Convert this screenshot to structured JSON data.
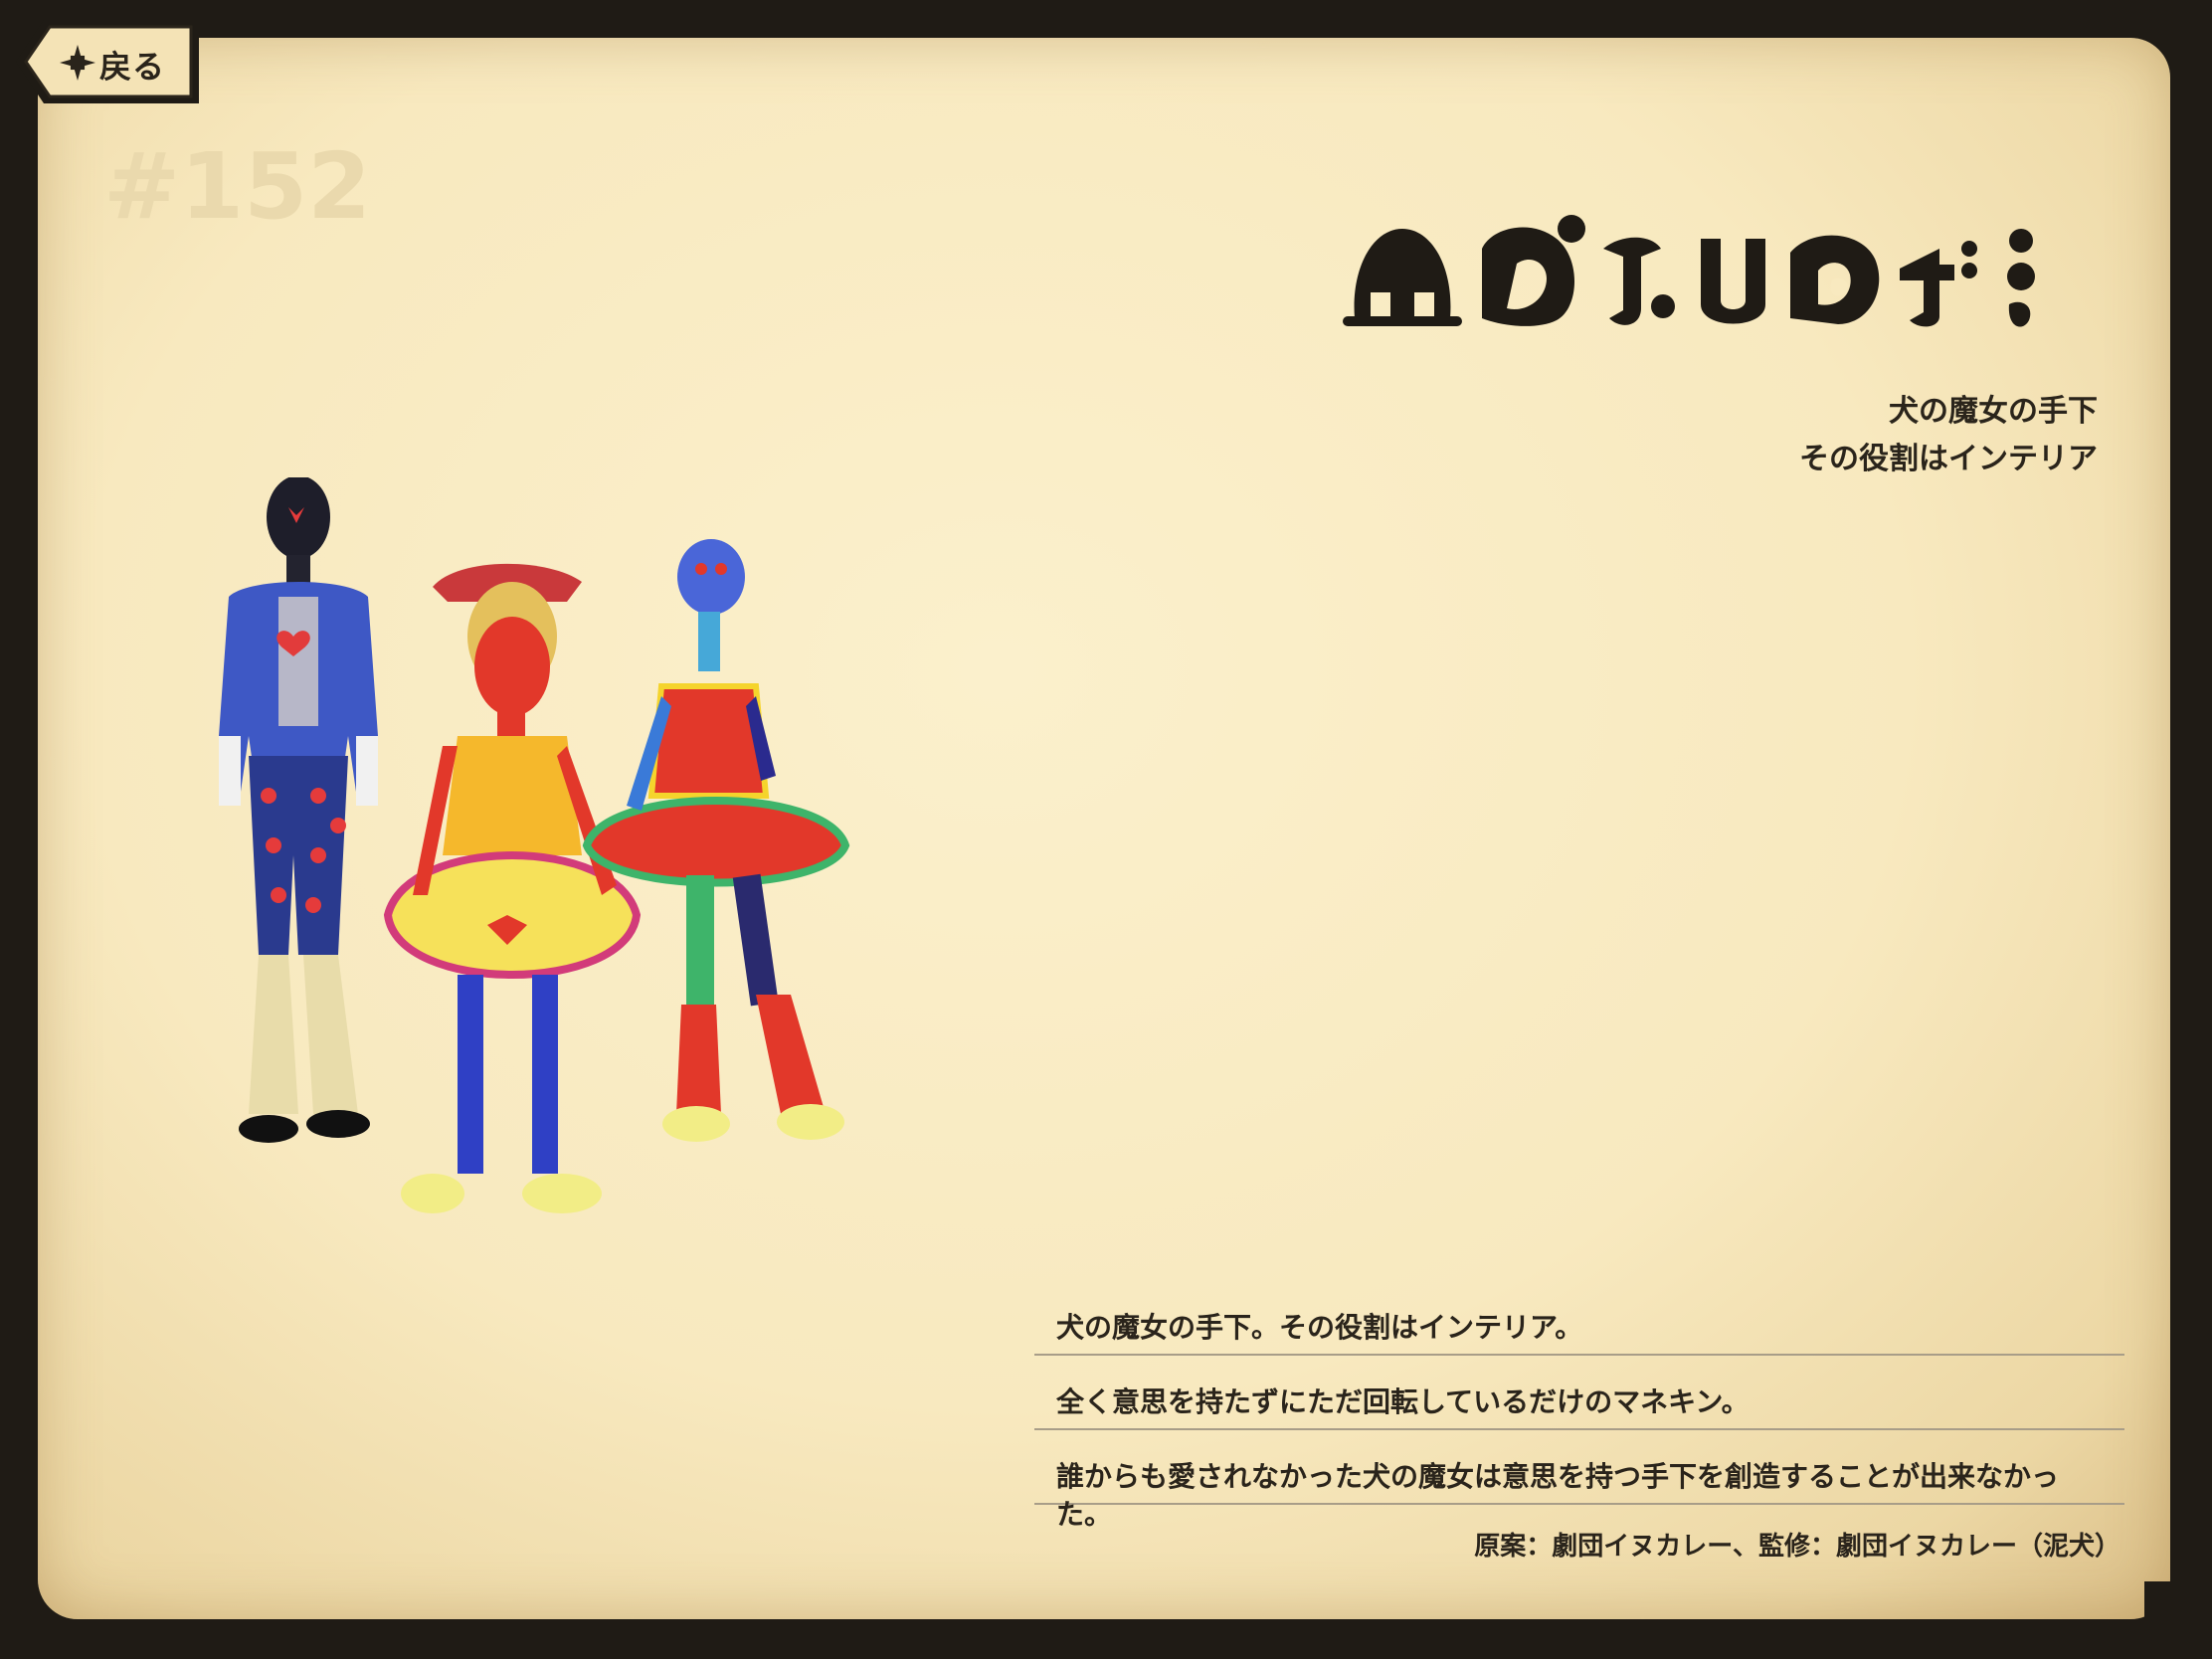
{
  "nav": {
    "back_label": "戻る"
  },
  "entry": {
    "number": "#152",
    "subtitle_lines": [
      "犬の魔女の手下",
      "その役割はインテリア"
    ],
    "description_lines": [
      "犬の魔女の手下。その役割はインテリア。",
      "全く意思を持たずにただ回転しているだけのマネキン。",
      "誰からも愛されなかった犬の魔女は意思を持つ手下を創造することが出来なかった。"
    ],
    "credit": "原案：劇団イヌカレー、監修：劇団イヌカレー（泥犬）"
  },
  "icons": {
    "back": "star-burst-icon"
  },
  "colors": {
    "background": "#1f1b15",
    "paper": "#f8e9bf",
    "text": "#2a241b",
    "number": "#ead9ad"
  }
}
